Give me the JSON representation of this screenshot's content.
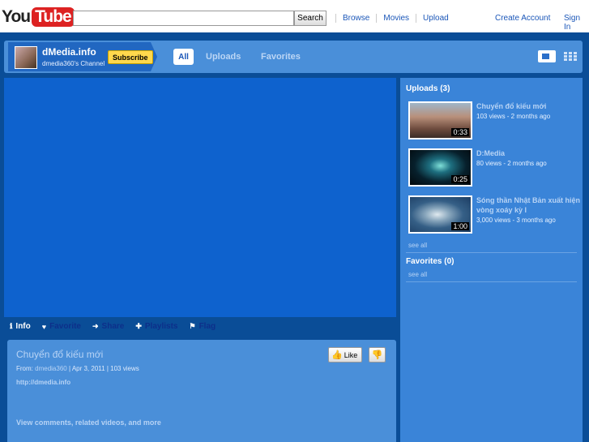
{
  "header": {
    "logo_you": "You",
    "logo_tube": "Tube",
    "search_value": "",
    "search_button": "Search",
    "nav": [
      "Browse",
      "Movies",
      "Upload"
    ],
    "create_account": "Create Account",
    "sign_in": "Sign In"
  },
  "channel": {
    "name": "dMedia.info",
    "subtitle": "dmedia360's Channel",
    "subscribe": "Subscribe",
    "tabs": [
      "All",
      "Uploads",
      "Favorites"
    ]
  },
  "actions": [
    "Info",
    "Favorite",
    "Share",
    "Playlists",
    "Flag"
  ],
  "video": {
    "title": "Chuyển đổ kiếu mới",
    "from_label": "From:",
    "user": "dmedia360",
    "date": "Apr 3, 2011",
    "views": "103 views",
    "url": "http://dmedia.info",
    "more": "View comments, related videos, and more",
    "like": "Like"
  },
  "sidebar": {
    "uploads_title": "Uploads (3)",
    "uploads": [
      {
        "title": "Chuyển đổ kiếu mới",
        "meta": "103 views - 2 months ago",
        "duration": "0:33"
      },
      {
        "title": "D:Media",
        "meta": "80 views - 2 months ago",
        "duration": "0:25"
      },
      {
        "title": "Sóng thần Nhật Bản xuất hiện vòng xoáy kỳ l",
        "meta": "3,000 views - 3 months ago",
        "duration": "1:00"
      }
    ],
    "see_all": "see all",
    "favorites_title": "Favorites (0)",
    "favorites_see_all": "see all"
  },
  "colors": {
    "page_bg": "#0a4d97",
    "panel": "#4a8fd9",
    "player": "#0e62ce",
    "subscribe": "#ffd84d"
  }
}
